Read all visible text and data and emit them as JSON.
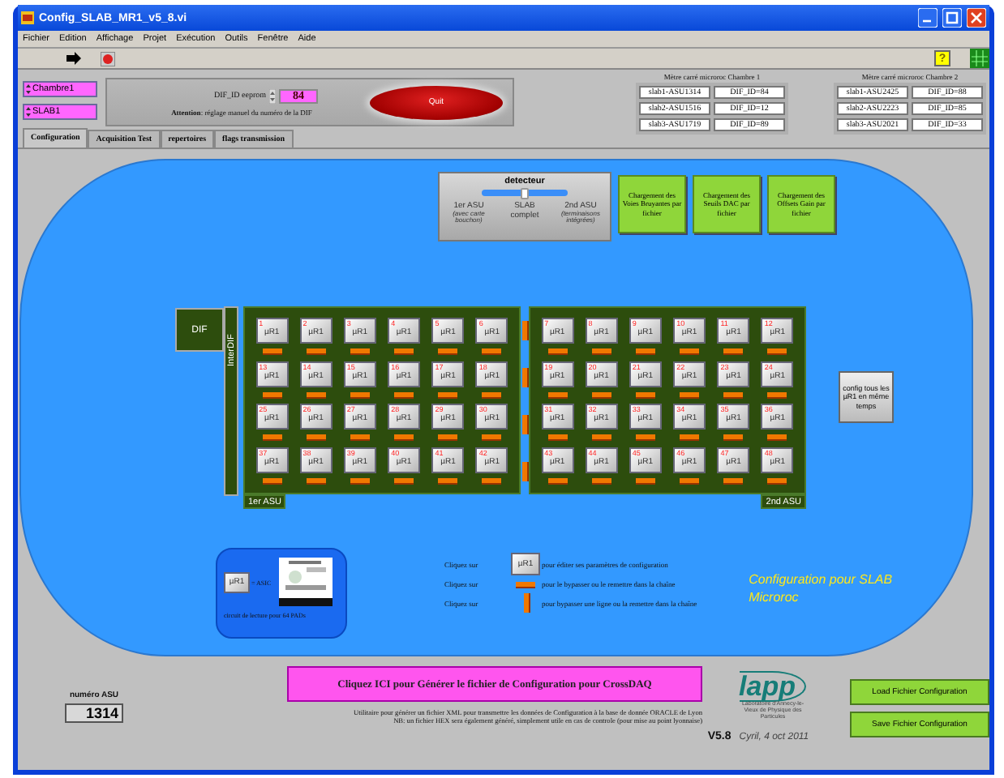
{
  "window": {
    "title": "Config_SLAB_MR1_v5_8.vi"
  },
  "menu": [
    "Fichier",
    "Edition",
    "Affichage",
    "Projet",
    "Exécution",
    "Outils",
    "Fenêtre",
    "Aide"
  ],
  "help": "?",
  "identity_fields": [
    {
      "value": "Chambre1"
    },
    {
      "value": "SLAB1"
    }
  ],
  "dif_id": {
    "label": "DIF_ID eeprom",
    "value": "84",
    "note": "**Attention**: réglage manuel du numéro de la DIF"
  },
  "quit_button": "Quit",
  "chambers": [
    {
      "title": "Mètre carré microroc Chambre 1",
      "rows": [
        [
          "slab1-ASU1314",
          "DIF_ID=84"
        ],
        [
          "slab2-ASU1516",
          "DIF_ID=12"
        ],
        [
          "slab3-ASU1719",
          "DIF_ID=89"
        ]
      ]
    },
    {
      "title": "Mètre carré microroc Chambre 2",
      "rows": [
        [
          "slab1-ASU2425",
          "DIF_ID=88"
        ],
        [
          "slab2-ASU2223",
          "DIF_ID=85"
        ],
        [
          "slab3-ASU2021",
          "DIF_ID=33"
        ]
      ]
    }
  ],
  "tabs": [
    {
      "label": "Configuration",
      "selected": true
    },
    {
      "label": "Acquisition Test",
      "selected": false
    },
    {
      "label": "repertoires",
      "selected": false
    },
    {
      "label": "flags transmission",
      "selected": false
    }
  ],
  "detector": {
    "title": "detecteur",
    "level": 0.5,
    "options": [
      {
        "label": "1er ASU",
        "note": "(avec carte bouchon)"
      },
      {
        "label": "SLAB complet"
      },
      {
        "label": "2nd ASU",
        "note": "(terminaisons intégrées)"
      }
    ]
  },
  "load_buttons": [
    "Chargement des Voies Bruyantes par fichier",
    "Chargement des Seuils DAC par fichier",
    "Chargement des Offsets Gain par fichier"
  ],
  "dif_label": "DIF",
  "interdif_label": "InterDIF",
  "asu_panels": [
    {
      "label": "1er ASU",
      "chips": [
        {
          "number": "1",
          "label": "µR1"
        },
        {
          "number": "2",
          "label": "µR1"
        },
        {
          "number": "3",
          "label": "µR1"
        },
        {
          "number": "4",
          "label": "µR1"
        },
        {
          "number": "5",
          "label": "µR1"
        },
        {
          "number": "6",
          "label": "µR1"
        },
        {
          "number": "13",
          "label": "µR1"
        },
        {
          "number": "14",
          "label": "µR1"
        },
        {
          "number": "15",
          "label": "µR1"
        },
        {
          "number": "16",
          "label": "µR1"
        },
        {
          "number": "17",
          "label": "µR1"
        },
        {
          "number": "18",
          "label": "µR1"
        },
        {
          "number": "25",
          "label": "µR1"
        },
        {
          "number": "26",
          "label": "µR1"
        },
        {
          "number": "27",
          "label": "µR1"
        },
        {
          "number": "28",
          "label": "µR1"
        },
        {
          "number": "29",
          "label": "µR1"
        },
        {
          "number": "30",
          "label": "µR1"
        },
        {
          "number": "37",
          "label": "µR1"
        },
        {
          "number": "38",
          "label": "µR1"
        },
        {
          "number": "39",
          "label": "µR1"
        },
        {
          "number": "40",
          "label": "µR1"
        },
        {
          "number": "41",
          "label": "µR1"
        },
        {
          "number": "42",
          "label": "µR1"
        }
      ]
    },
    {
      "label": "2nd ASU",
      "chips": [
        {
          "number": "7",
          "label": "µR1"
        },
        {
          "number": "8",
          "label": "µR1"
        },
        {
          "number": "9",
          "label": "µR1"
        },
        {
          "number": "10",
          "label": "µR1"
        },
        {
          "number": "11",
          "label": "µR1"
        },
        {
          "number": "12",
          "label": "µR1"
        },
        {
          "number": "19",
          "label": "µR1"
        },
        {
          "number": "20",
          "label": "µR1"
        },
        {
          "number": "21",
          "label": "µR1"
        },
        {
          "number": "22",
          "label": "µR1"
        },
        {
          "number": "23",
          "label": "µR1"
        },
        {
          "number": "24",
          "label": "µR1"
        },
        {
          "number": "31",
          "label": "µR1"
        },
        {
          "number": "32",
          "label": "µR1"
        },
        {
          "number": "33",
          "label": "µR1"
        },
        {
          "number": "34",
          "label": "µR1"
        },
        {
          "number": "35",
          "label": "µR1"
        },
        {
          "number": "36",
          "label": "µR1"
        },
        {
          "number": "43",
          "label": "µR1"
        },
        {
          "number": "44",
          "label": "µR1"
        },
        {
          "number": "45",
          "label": "µR1"
        },
        {
          "number": "46",
          "label": "µR1"
        },
        {
          "number": "47",
          "label": "µR1"
        },
        {
          "number": "48",
          "label": "µR1"
        }
      ]
    }
  ],
  "config_all_button": "config tous les µR1 en même temps",
  "legend_card": {
    "chip_label": "µR1",
    "equals": "= ASIC",
    "caption": "circuit de lecture pour 64 PADs"
  },
  "legend": [
    {
      "kind": "chip",
      "before": "Cliquez sur",
      "chip": "µR1",
      "after": "pour éditer ses paramètres de configuration"
    },
    {
      "kind": "hbar",
      "before": "Cliquez sur",
      "after": "pour le bypasser ou le remettre dans la chaîne"
    },
    {
      "kind": "vbar",
      "before": "Cliquez sur",
      "after": "pour  bypasser une ligne ou la remettre dans la chaîne"
    }
  ],
  "panel_title": "Configuration pour SLAB Microroc",
  "asu_number": {
    "label": "numéro ASU",
    "value": "1314"
  },
  "generate_button": "Cliquez ICI pour Générer le fichier de Configuration pour CrossDAQ",
  "generate_notes": [
    "Utilitaire pour générer un fichier XML pour transmettre les données de Configuration à la base de donnée ORACLE de Lyon",
    "NB: un fichier HEX sera également généré, simplement utile en cas de controle (pour mise au point lyonnaise)"
  ],
  "logo": {
    "name": "lapp",
    "caption": "Laboratoire d'Annecy-le-Vieux de Physique des Particules"
  },
  "version": "V5.8",
  "author": "Cyril, 4 oct 2011",
  "file_buttons": [
    "Load Fichier Configuration",
    "Save Fichier Configuration"
  ]
}
